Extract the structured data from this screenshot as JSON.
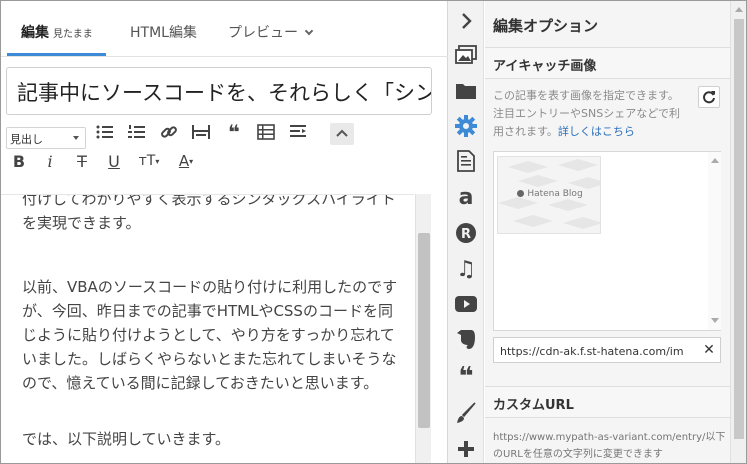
{
  "editor": {
    "tabs": [
      {
        "label": "編集",
        "sub": "見たまま"
      },
      {
        "label": "HTML編集"
      },
      {
        "label": "プレビュー"
      }
    ],
    "title_value": "記事中にソースコードを、それらしく「シンタックスハイライト」",
    "toolbar": {
      "heading_select": "見出し"
    },
    "paragraphs": [
      "付けしてわかりやすく表示するシンタックスハイライトを実現できます。",
      "以前、VBAのソースコードの貼り付けに利用したのですが、今回、昨日までの記事でHTMLやCSSのコードを同じように貼り付けようとして、やり方をすっかり忘れていました。しばらくやらないとまた忘れてしまいそうなので、憶えている間に記録しておきたいと思います。",
      "では、以下説明していきます。"
    ]
  },
  "iconbar": {
    "icons": [
      "chevron-right-icon",
      "image-icon",
      "folder-icon",
      "gear-icon",
      "document-icon",
      "amazon-icon",
      "rakuten-icon",
      "music-icon",
      "youtube-icon",
      "evernote-icon",
      "quote-icon",
      "brush-icon",
      "plus-icon"
    ],
    "accent_color": "#3d8ad6"
  },
  "panel": {
    "title": "編集オプション",
    "eyecatch": {
      "heading": "アイキャッチ画像",
      "description": "この記事を表す画像を指定できます。注目エントリーやSNSシェアなどで利用されます。",
      "link": "詳しくはこちら",
      "thumb_label": "Hatena Blog",
      "url_value": "https://cdn-ak.f.st-hatena.com/images/fotolife"
    },
    "custom_url": {
      "heading": "カスタムURL",
      "placeholder": "https://www.mypath-as-variant.com/entry/以下のURLを任意の文字列に変更できます"
    }
  }
}
